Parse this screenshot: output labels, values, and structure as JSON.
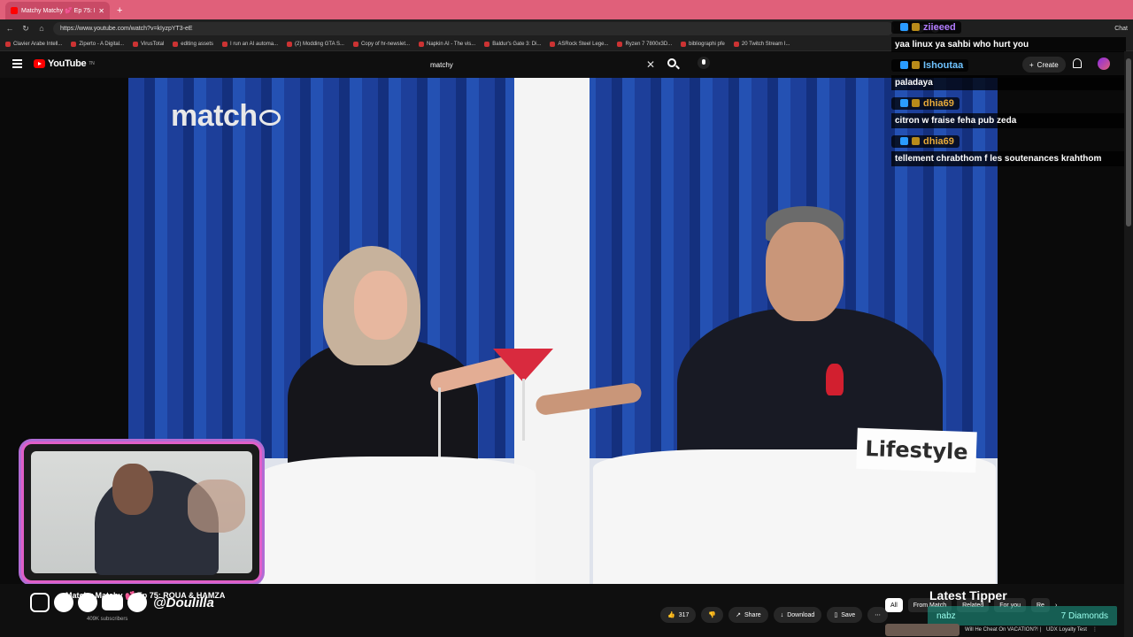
{
  "browser": {
    "tab_title": "Matchy Matchy 💕 Ep 75: ROUA & ...",
    "url": "https://www.youtube.com/watch?v=kIyzpYT3-eE",
    "chat_ext_label": "Chat",
    "bookmarks": [
      "Clavier Arabe Intell...",
      "Ziperto - A Digital...",
      "VirusTotal",
      "editing assets",
      "I run an AI automa...",
      "(2) Modding GTA S...",
      "Copy of hr-newslet...",
      "Napkin AI - The vis...",
      "Baldur's Gate 3: Di...",
      "ASRock Steel Lege...",
      "Ryzen 7 7800x3D...",
      "bibliographi pfe",
      "20 Twitch Stream I..."
    ]
  },
  "youtube": {
    "logo_text": "YouTube",
    "logo_sup": "TN",
    "search_query": "matchy",
    "create_label": "Create"
  },
  "video": {
    "brand": "match",
    "sign_text": "Lifestyle"
  },
  "chat": [
    {
      "user": "ziieeed",
      "color": "#b27cff",
      "text": "yaa linux ya sahbi who hurt you"
    },
    {
      "user": "Ishoutaa",
      "color": "#6fc3ff",
      "text": "paladaya"
    },
    {
      "user": "dhia69",
      "color": "#e6a93a",
      "text": "citron w fraise feha pub zeda"
    },
    {
      "user": "dhia69",
      "color": "#e6a93a",
      "text": "tellement chrabthom f les soutenances krahthom"
    }
  ],
  "below": {
    "title": "Matchy Matchy 💕 Ep 75: ROUA & HAMZA",
    "subscribers": "409K subscribers",
    "handle": "@Doulilla",
    "like_count": "317",
    "share_label": "Share",
    "download_label": "Download",
    "save_label": "Save",
    "chips": [
      "All",
      "From Match",
      "Related",
      "For you",
      "Re"
    ],
    "latest_tipper_label": "Latest Tipper",
    "tipper_name": "nabz",
    "tipper_amount": "7 Diamonds",
    "suggest_title": "Will He Cheat On VACATION?! |",
    "suggest_sub": "UDX Loyalty Test"
  }
}
